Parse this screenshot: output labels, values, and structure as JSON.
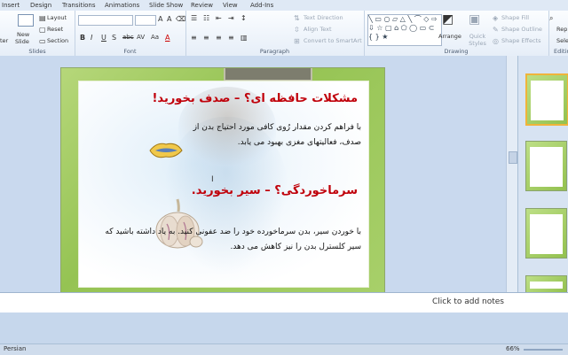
{
  "ribbon_tabs": [
    "Insert",
    "Design",
    "Transitions",
    "Animations",
    "Slide Show",
    "Review",
    "View",
    "Add-Ins"
  ],
  "slides_group": {
    "new_slide": "New",
    "new_slide2": "Slide",
    "filter_partial": "ter",
    "layout": "Layout",
    "reset": "Reset",
    "section": "Section",
    "label": "Slides"
  },
  "font_group": {
    "label": "Font",
    "bold": "B",
    "italic": "I",
    "underline": "U",
    "shadow": "S",
    "strike": "abc",
    "spacing": "AV",
    "case": "Aa",
    "color": "A"
  },
  "paragraph_group": {
    "label": "Paragraph",
    "text_direction": "Text Direction",
    "align_text": "Align Text",
    "smartart": "Convert to SmartArt"
  },
  "drawing_group": {
    "label": "Drawing",
    "arrange": "Arrange",
    "quick_styles": "Quick Styles",
    "shape_fill": "Shape Fill",
    "shape_outline": "Shape Outline",
    "shape_effects": "Shape Effects"
  },
  "editing_group": {
    "replace": "Repl",
    "select": "Selec",
    "label": "Editing"
  },
  "slide": {
    "heading1": "مشکلات حافظه ای؟  – صدف بخورید!",
    "body1": "با فراهم کردن مقدار رُوی کافی مورد احتیاج بدن از صدف، فعالیتهای مغزی بهبود می یابد.",
    "heading2": "سرماخوردگی؟  – سیر بخورید.",
    "body2": "با خوردن سیر، بدن سرماخورده خود را ضد عفونی کنید. به یاد داشته باشید که سیر کلسترل بدن را نیز کاهش می دهد."
  },
  "notes_placeholder": "Click to add notes",
  "status": {
    "language": "Persian",
    "zoom": "66%"
  }
}
